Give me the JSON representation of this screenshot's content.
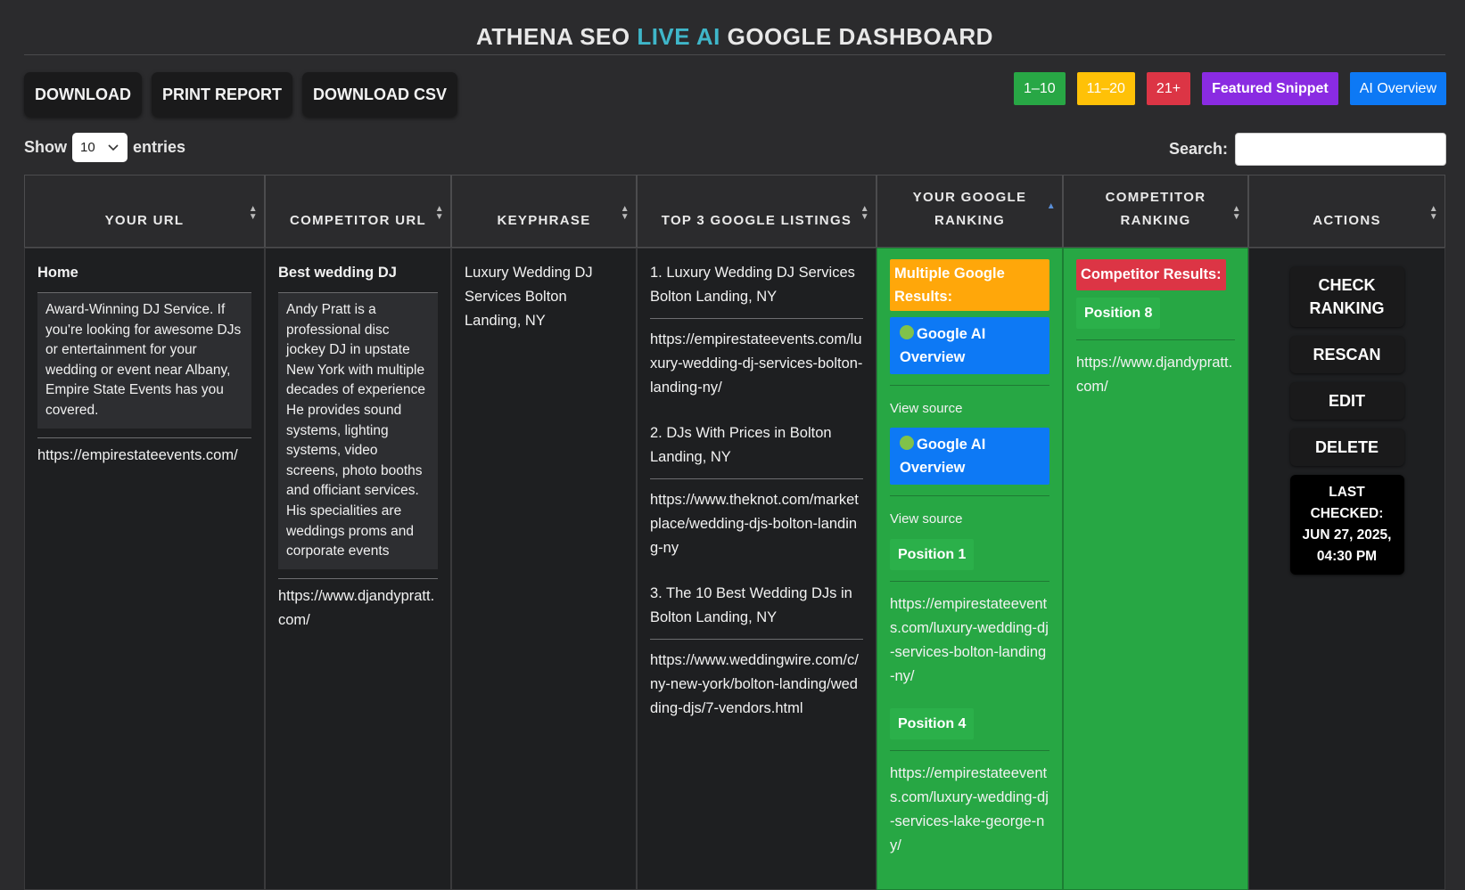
{
  "header": {
    "title_part1": "ATHENA SEO ",
    "title_accent": "LIVE AI",
    "title_part2": " GOOGLE DASHBOARD"
  },
  "toolbar": {
    "download": "DOWNLOAD",
    "print": "PRINT REPORT",
    "csv": "DOWNLOAD CSV"
  },
  "legend": {
    "r1": "1–10",
    "r2": "11–20",
    "r3": "21+",
    "snippet": "Featured Snippet",
    "ai": "AI Overview",
    "colors": {
      "r1": "#28a745",
      "r2": "#ffc107",
      "r3": "#dc3545",
      "snippet": "#8a2be2",
      "ai": "#0d79f5"
    }
  },
  "length": {
    "show": "Show",
    "value": "10",
    "entries": "entries"
  },
  "search": {
    "label": "Search:",
    "value": ""
  },
  "columns": {
    "your_url": "YOUR URL",
    "competitor_url": "COMPETITOR URL",
    "keyphrase": "KEYPHRASE",
    "top3": "TOP 3 GOOGLE LISTINGS",
    "your_ranking": "YOUR GOOGLE RANKING",
    "competitor_ranking": "COMPETITOR RANKING",
    "actions": "ACTIONS"
  },
  "row": {
    "your": {
      "title": "Home",
      "description": "Award-Winning DJ Service. If you're looking for awesome DJs or entertainment for your wedding or event near Albany, Empire State Events has you covered.",
      "url": "https://empirestateevents.com/"
    },
    "competitor": {
      "title": "Best wedding DJ",
      "description": "Andy Pratt is a professional disc jockey DJ in upstate New York with multiple decades of experience He provides sound systems, lighting systems, video screens, photo booths and officiant services. His specialities are weddings proms and corporate events",
      "url": "https://www.djandypratt.com/"
    },
    "keyphrase": "Luxury Wedding DJ Services Bolton Landing, NY",
    "top3": [
      {
        "title": "1. Luxury Wedding DJ Services Bolton Landing, NY",
        "url": "https://empirestateevents.com/luxury-wedding-dj-services-bolton-landing-ny/"
      },
      {
        "title": "2. DJs With Prices in Bolton Landing, NY",
        "url": "https://www.theknot.com/marketplace/wedding-djs-bolton-landing-ny"
      },
      {
        "title": "3. The 10 Best Wedding DJs in Bolton Landing, NY",
        "url": "https://www.weddingwire.com/c/ny-new-york/bolton-landing/wedding-djs/7-vendors.html"
      }
    ],
    "ranking": {
      "multiple": "Multiple Google Results:",
      "ai1": "Google AI Overview",
      "view1": "View source",
      "ai2": "Google AI Overview",
      "view2": "View source",
      "pos1": "Position 1",
      "url1": "https://empirestateevents.com/luxury-wedding-dj-services-bolton-landing-ny/",
      "pos2": "Position 4",
      "url2": "https://empirestateevents.com/luxury-wedding-dj-services-lake-george-ny/"
    },
    "competitor_ranking": {
      "label": "Competitor Results:",
      "pos": "Position 8",
      "url": "https://www.djandypratt.com/"
    },
    "actions": {
      "check": "CHECK RANKING",
      "rescan": "RESCAN",
      "edit": "EDIT",
      "delete": "DELETE",
      "last_checked_label": "LAST CHECKED:",
      "last_checked_value": "JUN 27, 2025, 04:30 PM"
    }
  }
}
